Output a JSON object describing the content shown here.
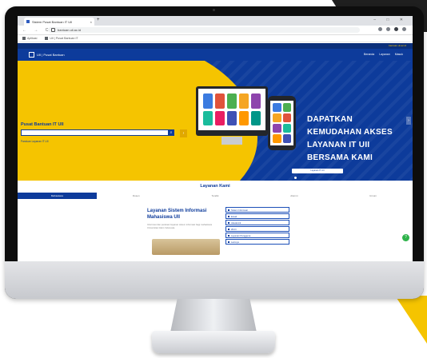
{
  "browser": {
    "tab_title": "Sistem Pusat Bantuan IT UII",
    "tab_close": "×",
    "new_tab": "+",
    "window_controls": "–  □  ✕",
    "nav_buttons": "←  →  C",
    "url": "bantuan.uii.ac.id",
    "bookmarks": [
      "Aplikasi",
      "UII | Pusat Bantuan IT"
    ]
  },
  "site": {
    "top_bar": "bantuan.uii.ac.id",
    "logo_text": "UII | Pusat Bantuan",
    "nav_links": [
      "Beranda",
      "Layanan",
      "Masuk"
    ]
  },
  "hero": {
    "search_title": "Pusat Bantuan IT UII",
    "search_placeholder": "",
    "search_button": "⌕",
    "arrow_button": "›",
    "search_hint": "Panduan Layanan IT UII",
    "cta_lines": [
      "DAPATKAN",
      "KEMUDAHAN AKSES",
      "LAYANAN IT UII",
      "BERSAMA KAMI"
    ],
    "badge_text": "Layanan IT UII",
    "next_button": "›"
  },
  "services": {
    "section_title": "Layanan Kami",
    "tabs": [
      "Mahasiswa",
      "Dosen",
      "Tendik",
      "Alumni",
      "Umum"
    ],
    "content_title_lines": [
      "Layanan Sistem Informasi",
      "Mahasiswa UII"
    ],
    "content_body": "Informasi dan panduan layanan sistem informasi bagi mahasiswa Universitas Islam Indonesia.",
    "list": [
      "Sistem Informasi",
      "Email",
      "Akademik",
      "Wi-Fi",
      "Layanan Pengguna",
      "Lainnya"
    ]
  },
  "chat_button": "?",
  "colors": {
    "brand_blue": "#0d3b9b",
    "brand_yellow": "#f5c400",
    "chat_green": "#2eb34a"
  },
  "app_tile_colors": [
    "#3b7be0",
    "#e0533b",
    "#4caf50",
    "#f5a623",
    "#8e44ad",
    "#1abc9c",
    "#e91e63",
    "#3f51b5",
    "#ff9800",
    "#009688"
  ],
  "phone_tile_colors": [
    "#3b7be0",
    "#4caf50",
    "#f5a623",
    "#e0533b",
    "#8e44ad",
    "#1abc9c",
    "#ff9800",
    "#3f51b5"
  ]
}
